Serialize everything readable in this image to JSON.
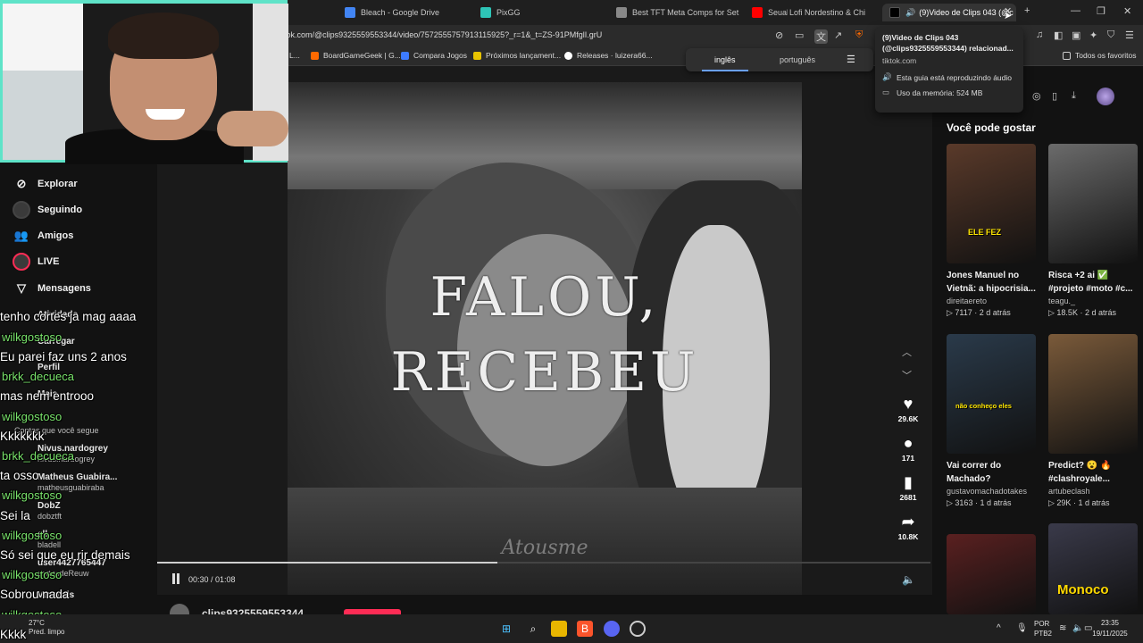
{
  "browser": {
    "tabs": [
      {
        "label": "d"
      },
      {
        "label": "Bleach - Google Drive"
      },
      {
        "label": "PixGG"
      },
      {
        "label": "Best TFT Meta Comps for Set 15"
      },
      {
        "label": "Seuab"
      },
      {
        "label": "Lofi Nordestino & Chi"
      },
      {
        "label": "(9)Video de Clips 043 (@c"
      }
    ],
    "url": "tok.com/@clips9325559553344/video/7572555757913115925?_r=1&_t=ZS-91PMfglI.grU",
    "bookmarks": [
      {
        "label": "L..."
      },
      {
        "label": "BoardGameGeek | G..."
      },
      {
        "label": "Compara Jogos"
      },
      {
        "label": "Próximos lançament..."
      },
      {
        "label": "Releases · luizera66..."
      }
    ],
    "all_favorites": "Todos os favoritos",
    "translate": {
      "active": "inglês",
      "other": "português"
    },
    "tooltip": {
      "title": "(9)Video de Clips 043 (@clips9325559553344) relacionad...",
      "domain": "tiktok.com",
      "audio": "Esta guia está reproduzindo áudio",
      "memory": "Uso da memória: 524 MB"
    }
  },
  "left_nav": {
    "items": [
      {
        "label": "Explorar"
      },
      {
        "label": "Seguindo"
      },
      {
        "label": "Amigos"
      },
      {
        "label": "LIVE"
      },
      {
        "label": "Mensagens"
      }
    ],
    "ghost": {
      "atividade": "Atividade",
      "carregar": "Carregar",
      "perfil": "Perfil",
      "mais": "Mais",
      "following_header": "Contas que você segue",
      "accounts": [
        {
          "name": "Nivus.nardogrey",
          "handle": "nivus.nardogrey"
        },
        {
          "name": "Matheus Guabira...",
          "handle": "matheusguabiraba"
        },
        {
          "name": "DobZ",
          "handle": "dobztft"
        },
        {
          "name": "ell",
          "handle": "bladell"
        },
        {
          "name": "user4427765447",
          "handle": "cortesdeReuw"
        },
        {
          "name": "Ver mais",
          "handle": ""
        }
      ]
    }
  },
  "chat": [
    {
      "user": "",
      "msg": "tenho cortes ja mag aaaa"
    },
    {
      "user": "wilkgostoso",
      "msg": "Eu parei faz uns 2 anos"
    },
    {
      "user": "brkk_decueca",
      "msg": "mas nem entrooo"
    },
    {
      "user": "wilkgostoso",
      "msg": "Kkkkkkk"
    },
    {
      "user": "brkk_decueca",
      "msg": "ta osso"
    },
    {
      "user": "wilkgostoso",
      "msg": "Sei la"
    },
    {
      "user": "wilkgostoso",
      "msg": "Só sei que eu rir demais"
    },
    {
      "user": "wilkgostoso",
      "msg": "Sobrou nada"
    },
    {
      "user": "wilkgostoso",
      "msg": "Kkkk"
    }
  ],
  "video": {
    "caption_line1": "FALOU,",
    "caption_line2": "RECEBEU",
    "watermark": "Atousme",
    "time": "00:30 / 01:08",
    "progress": 0.44,
    "author": "clips9325559553344"
  },
  "actions": {
    "likes": "29.6K",
    "comments": "171",
    "saves": "2681",
    "shares": "10.8K"
  },
  "recommended": {
    "title": "Você pode gostar",
    "cards": [
      {
        "caption": "Jones Manuel no Vietnã: a hipocrisia...",
        "author": "direitaereto",
        "views": "7117",
        "age": "2 d atrás",
        "thumb_text": "ELE FEZ",
        "color": "#5a3a2a"
      },
      {
        "caption": "Risca +2 ai ✅ #projeto #moto #c...",
        "author": "teagu._",
        "views": "18.5K",
        "age": "2 d atrás",
        "thumb_text": "",
        "color": "#6b6b6b"
      },
      {
        "caption": "Vai correr do Machado?",
        "author": "gustavomachadotakes",
        "views": "3163",
        "age": "1 d atrás",
        "thumb_text": "não conheço eles",
        "color": "#2a3a4a"
      },
      {
        "caption": "Predict? 😮 🔥 #clashroyale...",
        "author": "artubeclash",
        "views": "29K",
        "age": "1 d atrás",
        "thumb_text": "",
        "color": "#7a5a3a"
      },
      {
        "caption": "",
        "author": "",
        "views": "",
        "age": "",
        "thumb_text": "",
        "color": "#5a2020"
      },
      {
        "caption": "",
        "author": "",
        "views": "",
        "age": "",
        "thumb_text": "Monoco",
        "color": "#3a3a4a"
      }
    ]
  },
  "taskbar": {
    "weather_temp": "27°C",
    "weather_desc": "Pred. limpo",
    "lang": "POR",
    "layout": "PTB2",
    "time": "23:35",
    "date": "19/11/2025"
  }
}
